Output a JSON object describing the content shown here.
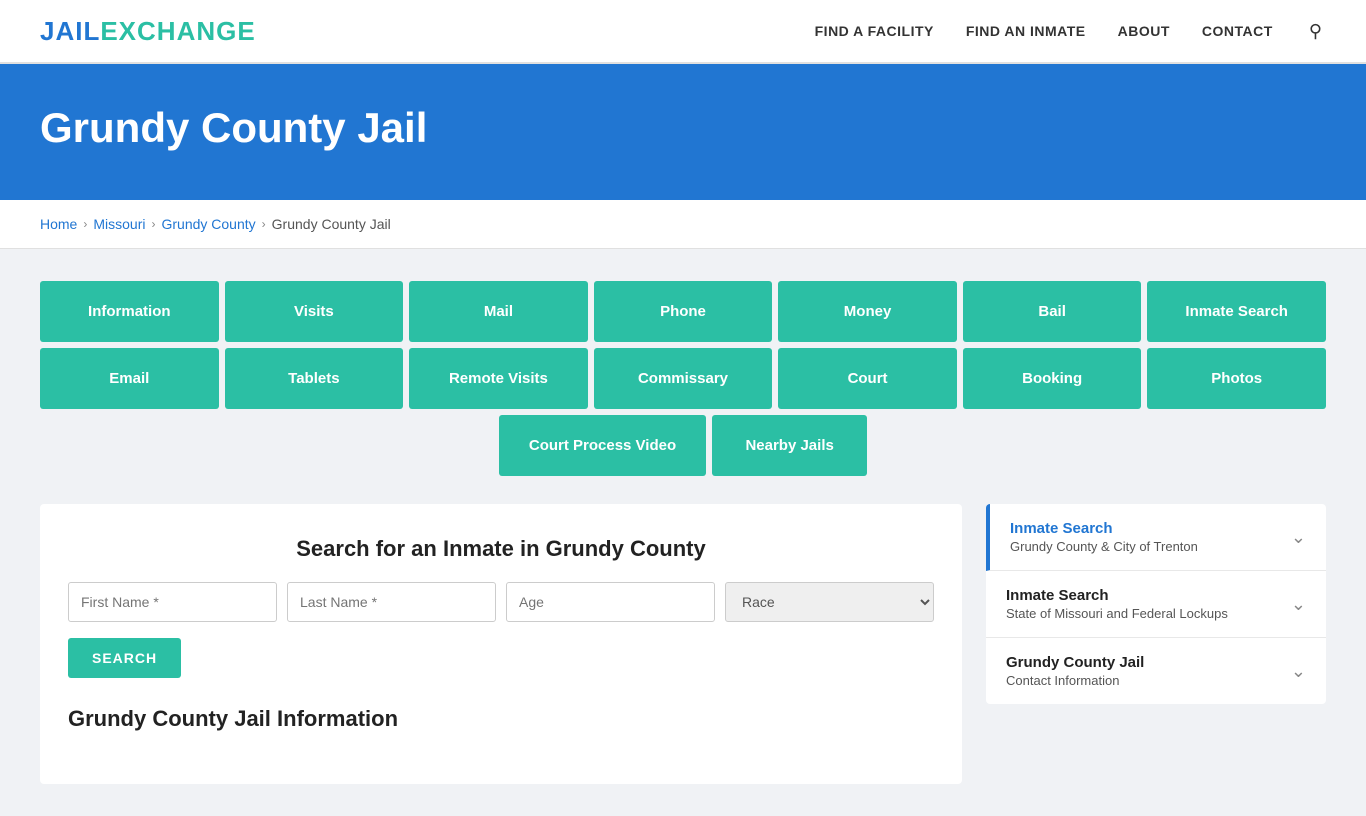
{
  "header": {
    "logo_jail": "JAIL",
    "logo_exchange": "EXCHANGE",
    "nav": [
      {
        "label": "FIND A FACILITY",
        "id": "find-facility"
      },
      {
        "label": "FIND AN INMATE",
        "id": "find-inmate"
      },
      {
        "label": "ABOUT",
        "id": "about"
      },
      {
        "label": "CONTACT",
        "id": "contact"
      }
    ]
  },
  "hero": {
    "title": "Grundy County Jail"
  },
  "breadcrumb": [
    {
      "label": "Home",
      "id": "home"
    },
    {
      "label": "Missouri",
      "id": "missouri"
    },
    {
      "label": "Grundy County",
      "id": "grundy-county"
    },
    {
      "label": "Grundy County Jail",
      "id": "grundy-county-jail"
    }
  ],
  "buttons_row1": [
    "Information",
    "Visits",
    "Mail",
    "Phone",
    "Money",
    "Bail",
    "Inmate Search"
  ],
  "buttons_row2": [
    "Email",
    "Tablets",
    "Remote Visits",
    "Commissary",
    "Court",
    "Booking",
    "Photos"
  ],
  "buttons_row3": [
    "Court Process Video",
    "Nearby Jails"
  ],
  "search": {
    "title": "Search for an Inmate in Grundy County",
    "first_name_placeholder": "First Name *",
    "last_name_placeholder": "Last Name *",
    "age_placeholder": "Age",
    "race_placeholder": "Race",
    "search_button": "SEARCH"
  },
  "info_heading": "Grundy County Jail Information",
  "sidebar": {
    "items": [
      {
        "title": "Inmate Search",
        "subtitle": "Grundy County & City of Trenton",
        "active": true
      },
      {
        "title": "Inmate Search",
        "subtitle": "State of Missouri and Federal Lockups",
        "active": false
      },
      {
        "title": "Grundy County Jail",
        "subtitle": "Contact Information",
        "active": false
      }
    ]
  }
}
